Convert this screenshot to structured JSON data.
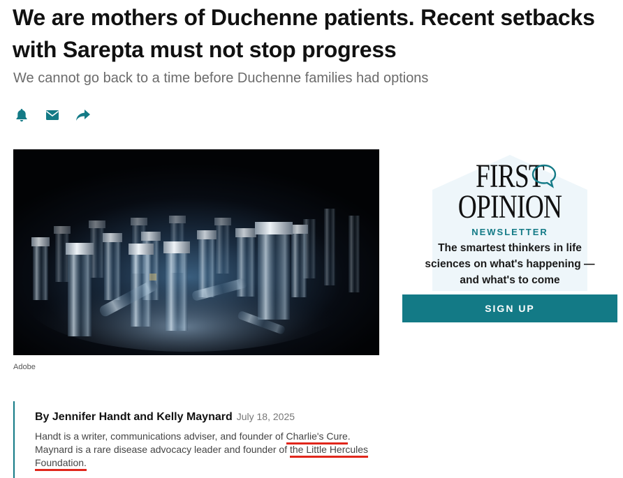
{
  "article": {
    "headline": "We are mothers of Duchenne patients. Recent setbacks with Sarepta must not stop progress",
    "dek": "We cannot go back to a time before Duchenne families had options",
    "image_caption": "Adobe",
    "byline": {
      "authors": "By Jennifer Handt and Kelly Maynard",
      "date": "July 18, 2025"
    },
    "bio": {
      "part1": "Handt is a writer, communications adviser, and founder of ",
      "link1": "Charlie's Cure",
      "part2": ". Maynard is a rare disease advocacy leader and founder of ",
      "link2": "the Little Hercules Foundation."
    }
  },
  "share_icons": [
    "bell-icon",
    "email-icon",
    "share-icon"
  ],
  "newsletter": {
    "logo_line1": "FIRST",
    "logo_line2": "OPINION",
    "label": "NEWSLETTER",
    "description": "The smartest thinkers in life sciences on what's happening — and what's to come",
    "button_label": "SIGN UP"
  },
  "colors": {
    "accent": "#137a86",
    "link_underline": "#e0261b",
    "headline": "#111111",
    "dek": "#6b6b6b"
  }
}
